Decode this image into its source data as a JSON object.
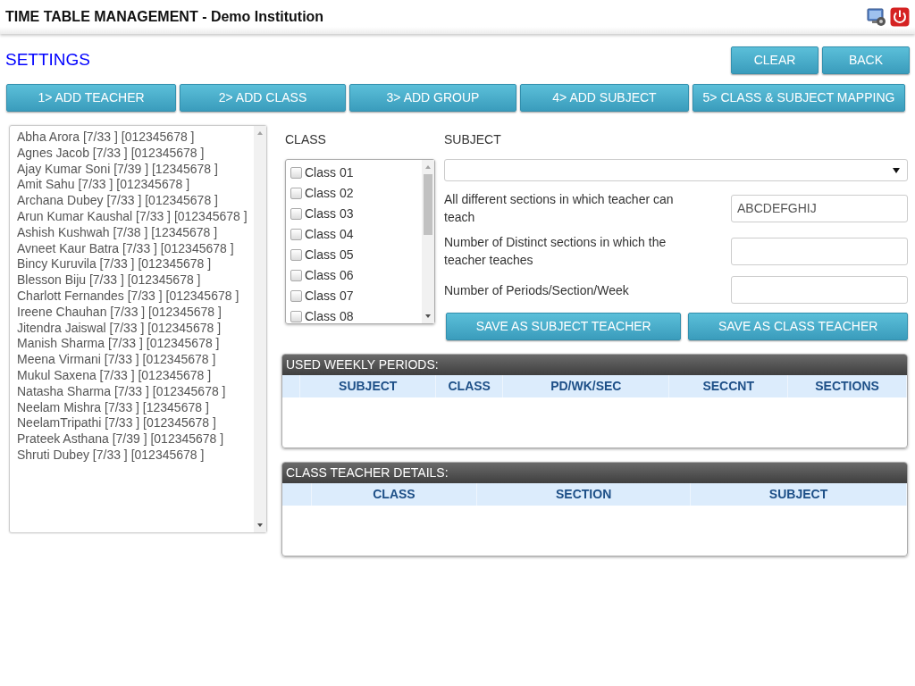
{
  "header": {
    "title": "TIME TABLE MANAGEMENT - Demo Institution"
  },
  "page_title": "SETTINGS",
  "top_buttons": [
    "CLEAR",
    "BACK"
  ],
  "steps": [
    {
      "label": "1> ADD TEACHER"
    },
    {
      "label": "2> ADD CLASS"
    },
    {
      "label": "3> ADD GROUP"
    },
    {
      "label": "4> ADD SUBJECT"
    },
    {
      "label": "5> CLASS & SUBJECT MAPPING"
    }
  ],
  "teachers": [
    "Abha Arora [7/33 ] [012345678 ]",
    "Agnes Jacob [7/33 ] [012345678 ]",
    "Ajay Kumar Soni [7/39 ] [12345678 ]",
    "Amit Sahu [7/33 ] [012345678 ]",
    "Archana Dubey [7/33 ] [012345678 ]",
    "Arun Kumar Kaushal [7/33 ] [012345678 ]",
    "Ashish Kushwah [7/38 ] [12345678 ]",
    "Avneet Kaur Batra [7/33 ] [012345678 ]",
    "Bincy Kuruvila [7/33 ] [012345678 ]",
    "Blesson Biju [7/33 ] [012345678 ]",
    "Charlott Fernandes [7/33 ] [012345678 ]",
    "Ireene Chauhan [7/33 ] [012345678 ]",
    "Jitendra Jaiswal [7/33 ] [012345678 ]",
    "Manish Sharma [7/33 ] [012345678 ]",
    "Meena Virmani [7/33 ] [012345678 ]",
    "Mukul Saxena [7/33 ] [012345678 ]",
    "Natasha Sharma [7/33 ] [012345678 ]",
    "Neelam Mishra [7/33 ] [12345678 ]",
    "NeelamTripathi [7/33 ] [012345678 ]",
    "Prateek Asthana [7/39 ] [012345678 ]",
    "Shruti Dubey [7/33 ] [012345678 ]"
  ],
  "class_label": "CLASS",
  "classes": [
    {
      "label": "Class 01",
      "checked": false
    },
    {
      "label": "Class 02",
      "checked": false
    },
    {
      "label": "Class 03",
      "checked": false
    },
    {
      "label": "Class 04",
      "checked": false
    },
    {
      "label": "Class 05",
      "checked": false
    },
    {
      "label": "Class 06",
      "checked": false
    },
    {
      "label": "Class 07",
      "checked": false
    },
    {
      "label": "Class 08",
      "checked": false
    }
  ],
  "subject_label": "SUBJECT",
  "fields": [
    {
      "label": "All different sections in which teacher can teach",
      "value": "ABCDEFGHIJ"
    },
    {
      "label": "Number of Distinct sections in which the teacher teaches"
    },
    {
      "label": "Number of Periods/Section/Week"
    }
  ],
  "save_buttons": [
    "SAVE AS SUBJECT TEACHER",
    "SAVE AS CLASS TEACHER"
  ],
  "tables": [
    {
      "title": "USED WEEKLY PERIODS:",
      "columns": [
        "SUBJECT",
        "CLASS",
        "PD/WK/SEC",
        "SECCNT",
        "SECTIONS"
      ]
    },
    {
      "title": "CLASS TEACHER DETAILS:",
      "columns": [
        "CLASS",
        "SECTION",
        "SUBJECT"
      ]
    }
  ]
}
